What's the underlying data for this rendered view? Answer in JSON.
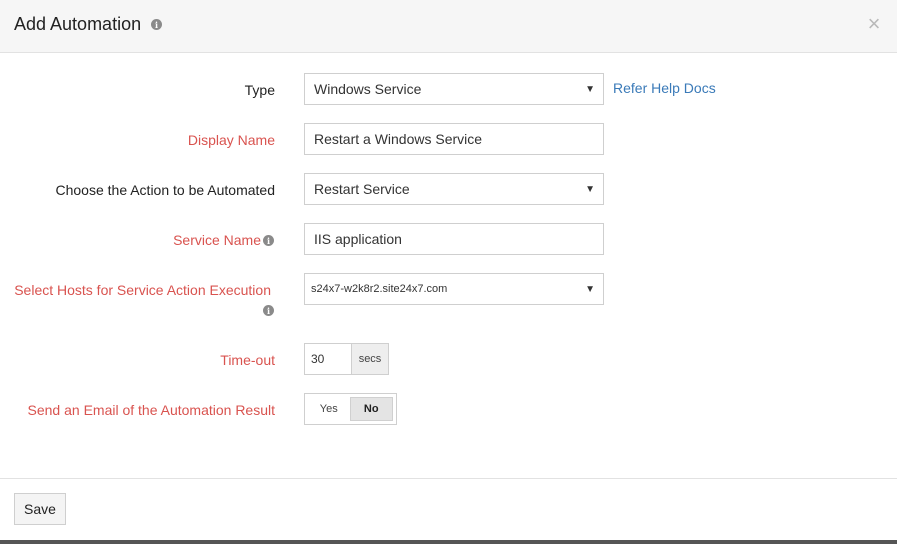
{
  "dialog": {
    "title": "Add Automation",
    "close_symbol": "×"
  },
  "form": {
    "type": {
      "label": "Type",
      "value": "Windows Service",
      "help_link": "Refer Help Docs"
    },
    "display_name": {
      "label": "Display Name",
      "value": "Restart a Windows Service"
    },
    "action": {
      "label": "Choose the Action to be Automated",
      "value": "Restart Service"
    },
    "service_name": {
      "label": "Service Name",
      "value": "IIS application"
    },
    "hosts": {
      "label": "Select Hosts for Service Action Execution",
      "value": "s24x7-w2k8r2.site24x7.com"
    },
    "timeout": {
      "label": "Time-out",
      "value": "30",
      "unit": "secs"
    },
    "email": {
      "label": "Send an Email of the Automation Result",
      "yes": "Yes",
      "no": "No",
      "selected": "No"
    }
  },
  "footer": {
    "save_label": "Save"
  },
  "icons": {
    "info": "info-icon",
    "close": "close-icon",
    "caret": "caret-down-icon"
  },
  "colors": {
    "required_label": "#d9534f",
    "link": "#3a7ab8"
  }
}
